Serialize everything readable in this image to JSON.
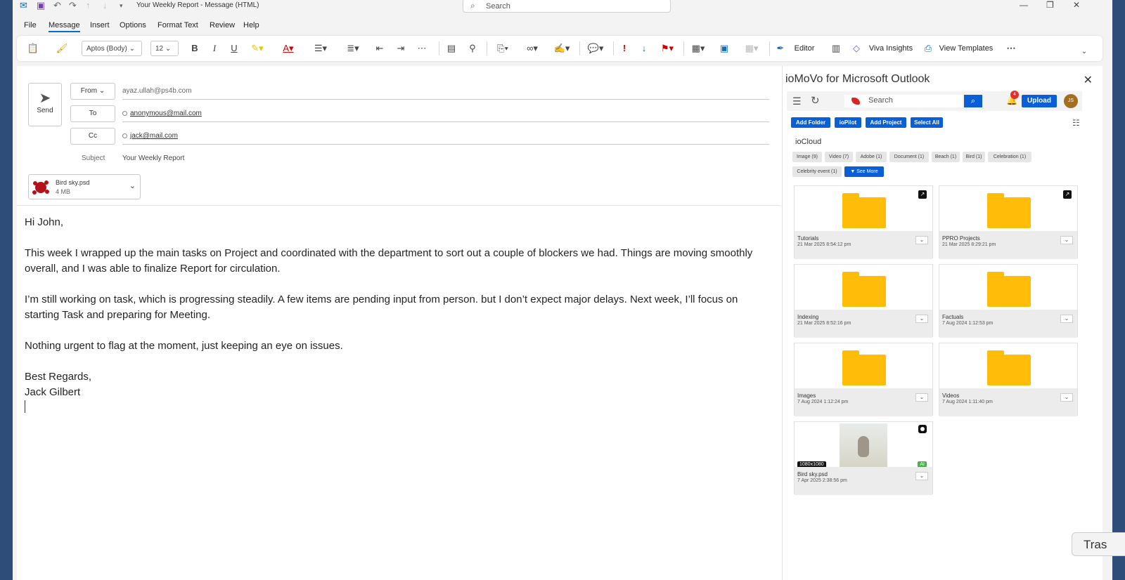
{
  "window": {
    "title": "Your Weekly Report  -  Message (HTML)",
    "search_placeholder": "Search"
  },
  "menu": [
    "File",
    "Message",
    "Insert",
    "Options",
    "Format Text",
    "Review",
    "Help"
  ],
  "ribbon": {
    "font": "Aptos (Body)",
    "size": "12",
    "bold": "B",
    "italic": "I",
    "underline": "U",
    "editor": "Editor",
    "viva": "Viva Insights",
    "templates": "View Templates"
  },
  "compose": {
    "send": "Send",
    "from_btn": "From",
    "from_value": "ayaz.ullah@ps4b.com",
    "to_btn": "To",
    "to_value": "anonymous@mail.com",
    "cc_btn": "Cc",
    "cc_value": "jack@mail.com",
    "subject_label": "Subject",
    "subject_value": "Your Weekly Report",
    "attachment": {
      "name": "Bird sky.psd",
      "size": "4 MB"
    },
    "body": {
      "greeting": "Hi John,",
      "p1": "This week I wrapped up the main tasks on Project and coordinated with the department to sort out a couple of blockers we had. Things are moving smoothly overall, and I was able to finalize Report for circulation.",
      "p2": "I’m still working on task, which is progressing steadily. A few items are pending input from person. but I don’t expect major delays. Next week, I’ll focus on starting Task and preparing for Meeting.",
      "p3": "Nothing urgent to flag at the moment, just keeping an eye on issues.",
      "closing": "Best Regards,",
      "signature": "Jack Gilbert"
    }
  },
  "panel": {
    "title": "ioMoVo for Microsoft Outlook",
    "search_placeholder": "Search",
    "notifications": "4",
    "upload": "Upload",
    "avatar": "JS",
    "actions": [
      "Add Folder",
      "ioPilot",
      "Add Project",
      "Select All"
    ],
    "section": "ioCloud",
    "chips": [
      "Image (9)",
      "Video (7)",
      "Adobe (1)",
      "Document (1)",
      "Beach (1)",
      "Bird (1)",
      "Celebration (1)",
      "Celebrity event (1)"
    ],
    "see_more": "See More",
    "items": [
      {
        "name": "Tutorials",
        "date": "21 Mar 2025 8:54:12 pm"
      },
      {
        "name": "PPRO Projects",
        "date": "21 Mar 2025 8:29:21 pm"
      },
      {
        "name": "Indexing",
        "date": "21 Mar 2025 8:52:16 pm"
      },
      {
        "name": "Factuals",
        "date": "7 Aug 2024 1:12:53 pm"
      },
      {
        "name": "Images",
        "date": "7 Aug 2024 1:12:24 pm"
      },
      {
        "name": "Videos",
        "date": "7 Aug 2024 1:11:40 pm"
      },
      {
        "name": "Bird sky.psd",
        "date": "7 Apr 2025 2:38:56 pm",
        "dims": "1080x1080",
        "ai": "AI"
      }
    ]
  },
  "taskbar_fragment": "Tras"
}
